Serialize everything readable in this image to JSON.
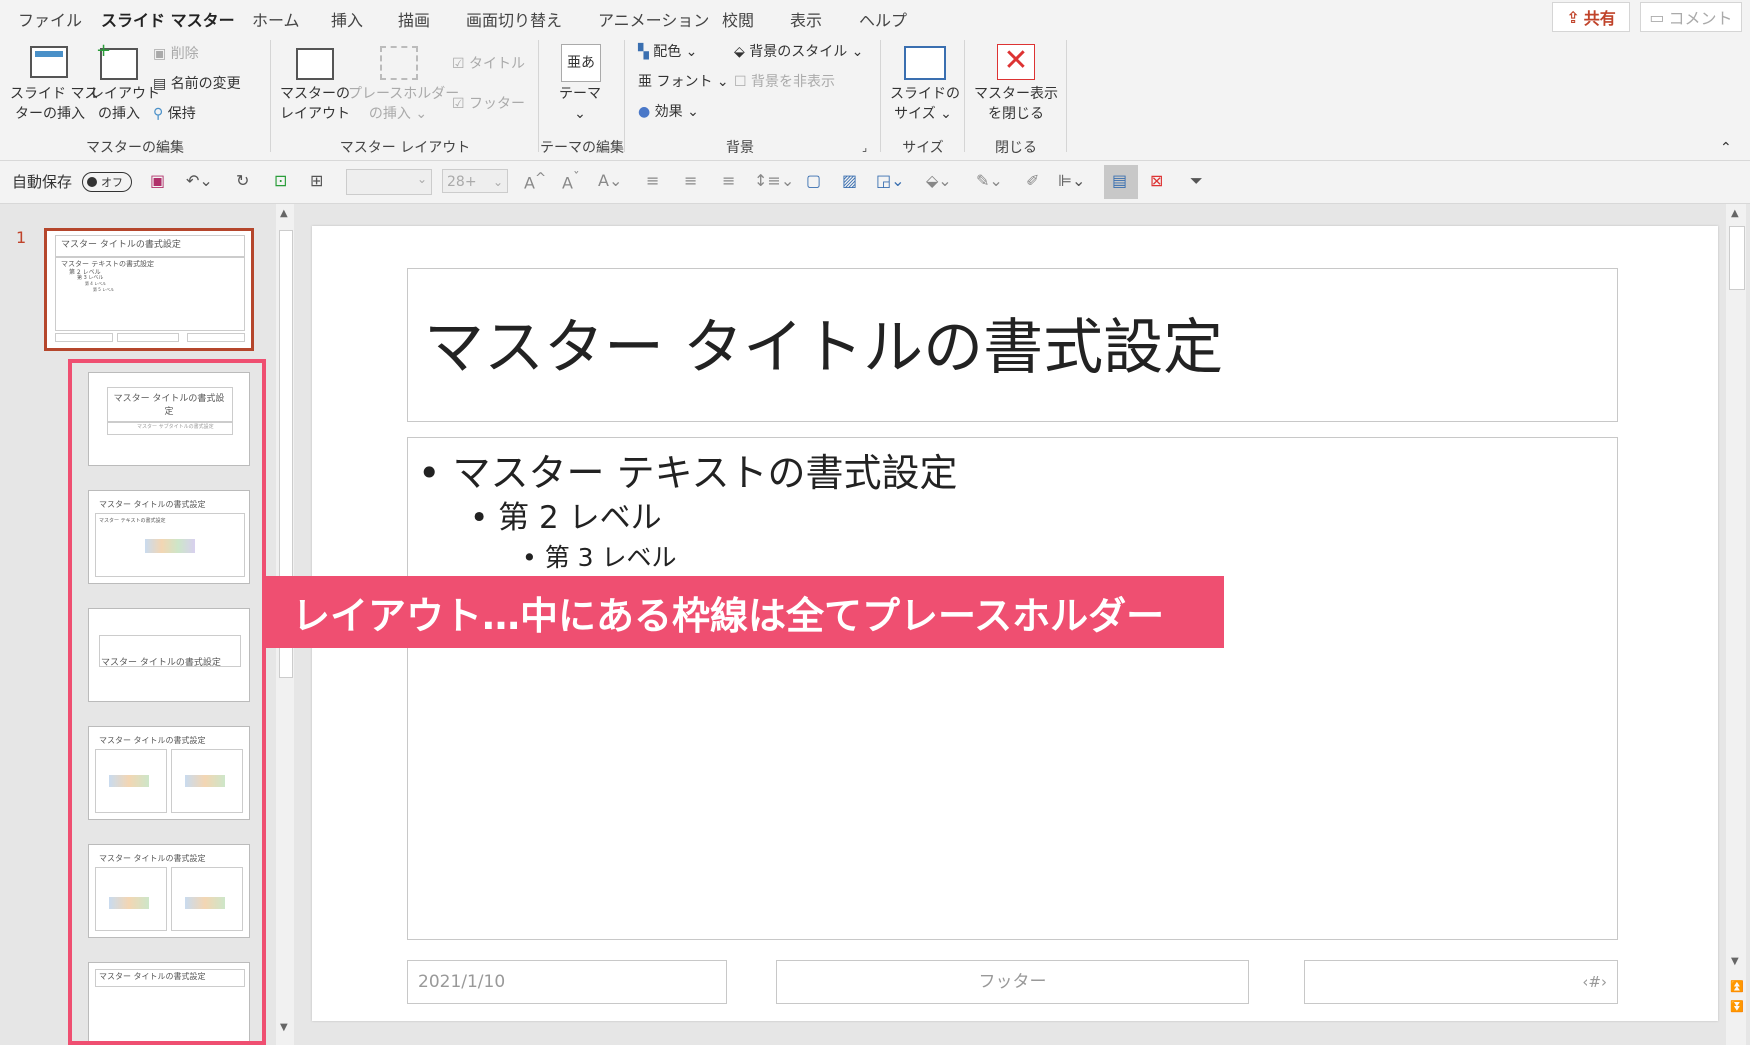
{
  "menu": {
    "tabs": [
      "ファイル",
      "スライド マスター",
      "ホーム",
      "挿入",
      "描画",
      "画面切り替え",
      "アニメーション",
      "校閲",
      "表示",
      "ヘルプ"
    ],
    "share": "共有",
    "comment": "コメント"
  },
  "ribbon": {
    "insert_master": [
      "スライド マス",
      "ターの挿入"
    ],
    "insert_layout": [
      "レイアウト",
      "の挿入"
    ],
    "delete": "削除",
    "rename": "名前の変更",
    "preserve": "保持",
    "group_master_edit": "マスターの編集",
    "master_layout": [
      "マスターの",
      "レイアウト"
    ],
    "insert_placeholder": [
      "プレースホルダー",
      "の挿入 ⌄"
    ],
    "title_chk": "タイトル",
    "footer_chk": "フッター",
    "group_master_layout": "マスター レイアウト",
    "theme": "テーマ",
    "group_theme_edit": "テーマの編集",
    "colors": "配色",
    "fonts": "フォント",
    "effects": "効果",
    "bg_style": "背景のスタイル",
    "hide_bg": "背景を非表示",
    "group_background": "背景",
    "slide_size": [
      "スライドの",
      "サイズ ⌄"
    ],
    "group_size": "サイズ",
    "close_master": [
      "マスター表示",
      "を閉じる"
    ],
    "group_close": "閉じる"
  },
  "qat": {
    "autosave": "自動保存",
    "toggle": "オフ",
    "fontsize": "28+"
  },
  "slide_number": "1",
  "thumbs": {
    "master_title": "マスター タイトルの書式設定",
    "master_body": [
      "マスター テキストの書式設定",
      "第 2 レベル",
      "第 3 レベル",
      "第 4 レベル",
      "第 5 レベル"
    ],
    "title_layout_title": "マスター タイトルの書式設定",
    "subtitle": "マスター サブタイトルの書式設定"
  },
  "slide": {
    "title": "マスター タイトルの書式設定",
    "level1": "マスター テキストの書式設定",
    "level2": "第 2 レベル",
    "level3": "第 3 レベル",
    "date": "2021/1/10",
    "footer": "フッター",
    "number": "‹#›"
  },
  "callout": "レイアウト…中にある枠線は全てプレースホルダー",
  "colors": {
    "accent": "#c0432a",
    "highlight": "#ef4f71"
  }
}
